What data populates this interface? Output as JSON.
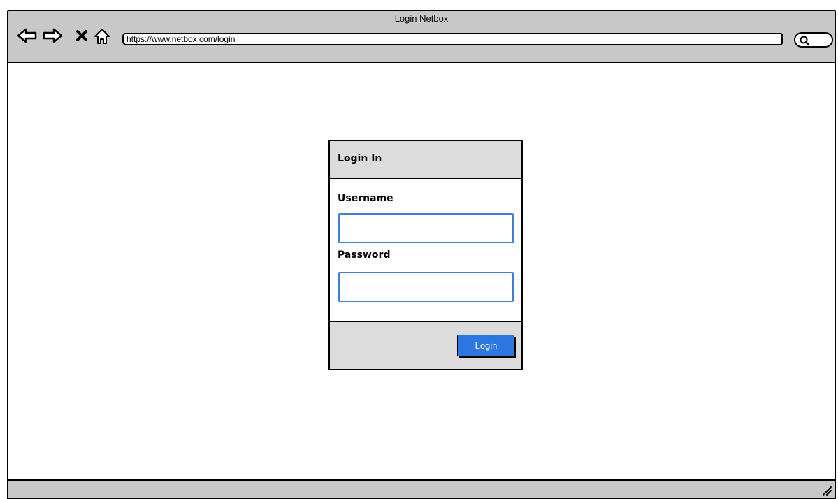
{
  "window": {
    "title": "Login Netbox"
  },
  "toolbar": {
    "url": "https://www.netbox.com/login",
    "icons": [
      "back-arrow-icon",
      "forward-arrow-icon",
      "close-icon",
      "home-icon",
      "search-icon"
    ]
  },
  "login": {
    "title": "Login In",
    "username_label": "Username",
    "username_value": "",
    "password_label": "Password",
    "password_value": "",
    "button_label": "Login"
  },
  "colors": {
    "chrome": "#c8c8c8",
    "panel": "#dcdcdc",
    "accent": "#2d78e0",
    "input_border": "#3d7fd9"
  }
}
